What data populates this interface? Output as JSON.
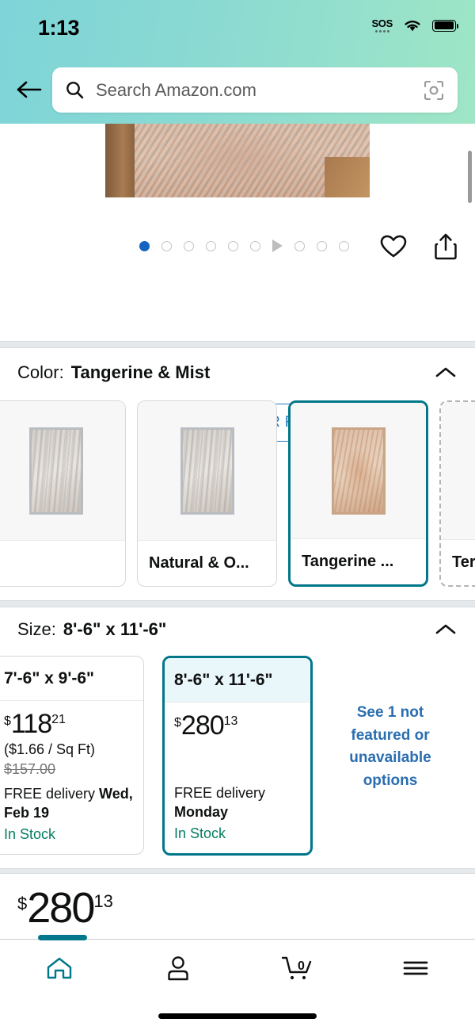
{
  "status_bar": {
    "time": "1:13",
    "sos_label": "SOS",
    "wifi_icon": "wifi-icon",
    "battery_icon": "battery-full-icon"
  },
  "header": {
    "back_icon": "back-arrow-icon",
    "search": {
      "placeholder": "Search Amazon.com",
      "search_icon": "search-icon",
      "camera_icon": "camera-scan-icon"
    }
  },
  "gallery": {
    "total_dots": 10,
    "active_index": 0,
    "video_index": 6,
    "wishlist_icon": "heart-icon",
    "share_icon": "share-icon",
    "ar_button": {
      "label": "VIEW IN YOUR ROOM",
      "icon": "ar-cube-icon"
    }
  },
  "color_section": {
    "label": "Color:",
    "value": "Tangerine & Mist",
    "collapse_icon": "chevron-up-icon",
    "swatches": [
      {
        "name": "",
        "state": "partial",
        "thumb": "rug-partial"
      },
      {
        "name": "Natural & O...",
        "state": "available",
        "thumb": "rug-natural"
      },
      {
        "name": "Tangerine ...",
        "state": "selected",
        "thumb": "rug-tangerine"
      },
      {
        "name": "Terracotta ...",
        "state": "unavailable",
        "thumb": "rug-terracotta"
      }
    ]
  },
  "size_section": {
    "label": "Size:",
    "value": "8'-6\" x 11'-6\"",
    "collapse_icon": "chevron-up-icon",
    "options": [
      {
        "size": "7'-6\" x 9'-6\"",
        "currency": "$",
        "whole": "118",
        "fraction": "21",
        "unit_price": "($1.66 / Sq Ft)",
        "list_price": "$157.00",
        "delivery_prefix": "FREE delivery ",
        "delivery_date": "Wed, Feb 19",
        "stock": "In Stock",
        "state": "available"
      },
      {
        "size": "8'-6\" x 11'-6\"",
        "currency": "$",
        "whole": "280",
        "fraction": "13",
        "unit_price": "",
        "list_price": "",
        "delivery_prefix": "FREE delivery ",
        "delivery_date": "Monday",
        "stock": "In Stock",
        "state": "selected"
      }
    ],
    "not_featured_link": "See 1 not featured or unavailable options"
  },
  "buybox": {
    "currency": "$",
    "whole": "280",
    "fraction": "13"
  },
  "bottom_nav": {
    "items": [
      {
        "name": "home",
        "icon": "home-icon",
        "active": true
      },
      {
        "name": "account",
        "icon": "person-icon",
        "active": false
      },
      {
        "name": "cart",
        "icon": "cart-icon",
        "badge": "0",
        "active": false
      },
      {
        "name": "menu",
        "icon": "hamburger-menu-icon",
        "active": false
      }
    ]
  },
  "colors": {
    "header_gradient_start": "#7ed4d8",
    "header_gradient_end": "#9fe6c6",
    "selection_teal": "#00778a",
    "link_blue": "#2a6eb0",
    "ar_blue": "#2a7bc4",
    "in_stock_green": "#067d62",
    "active_dot_blue": "#1565c0"
  }
}
